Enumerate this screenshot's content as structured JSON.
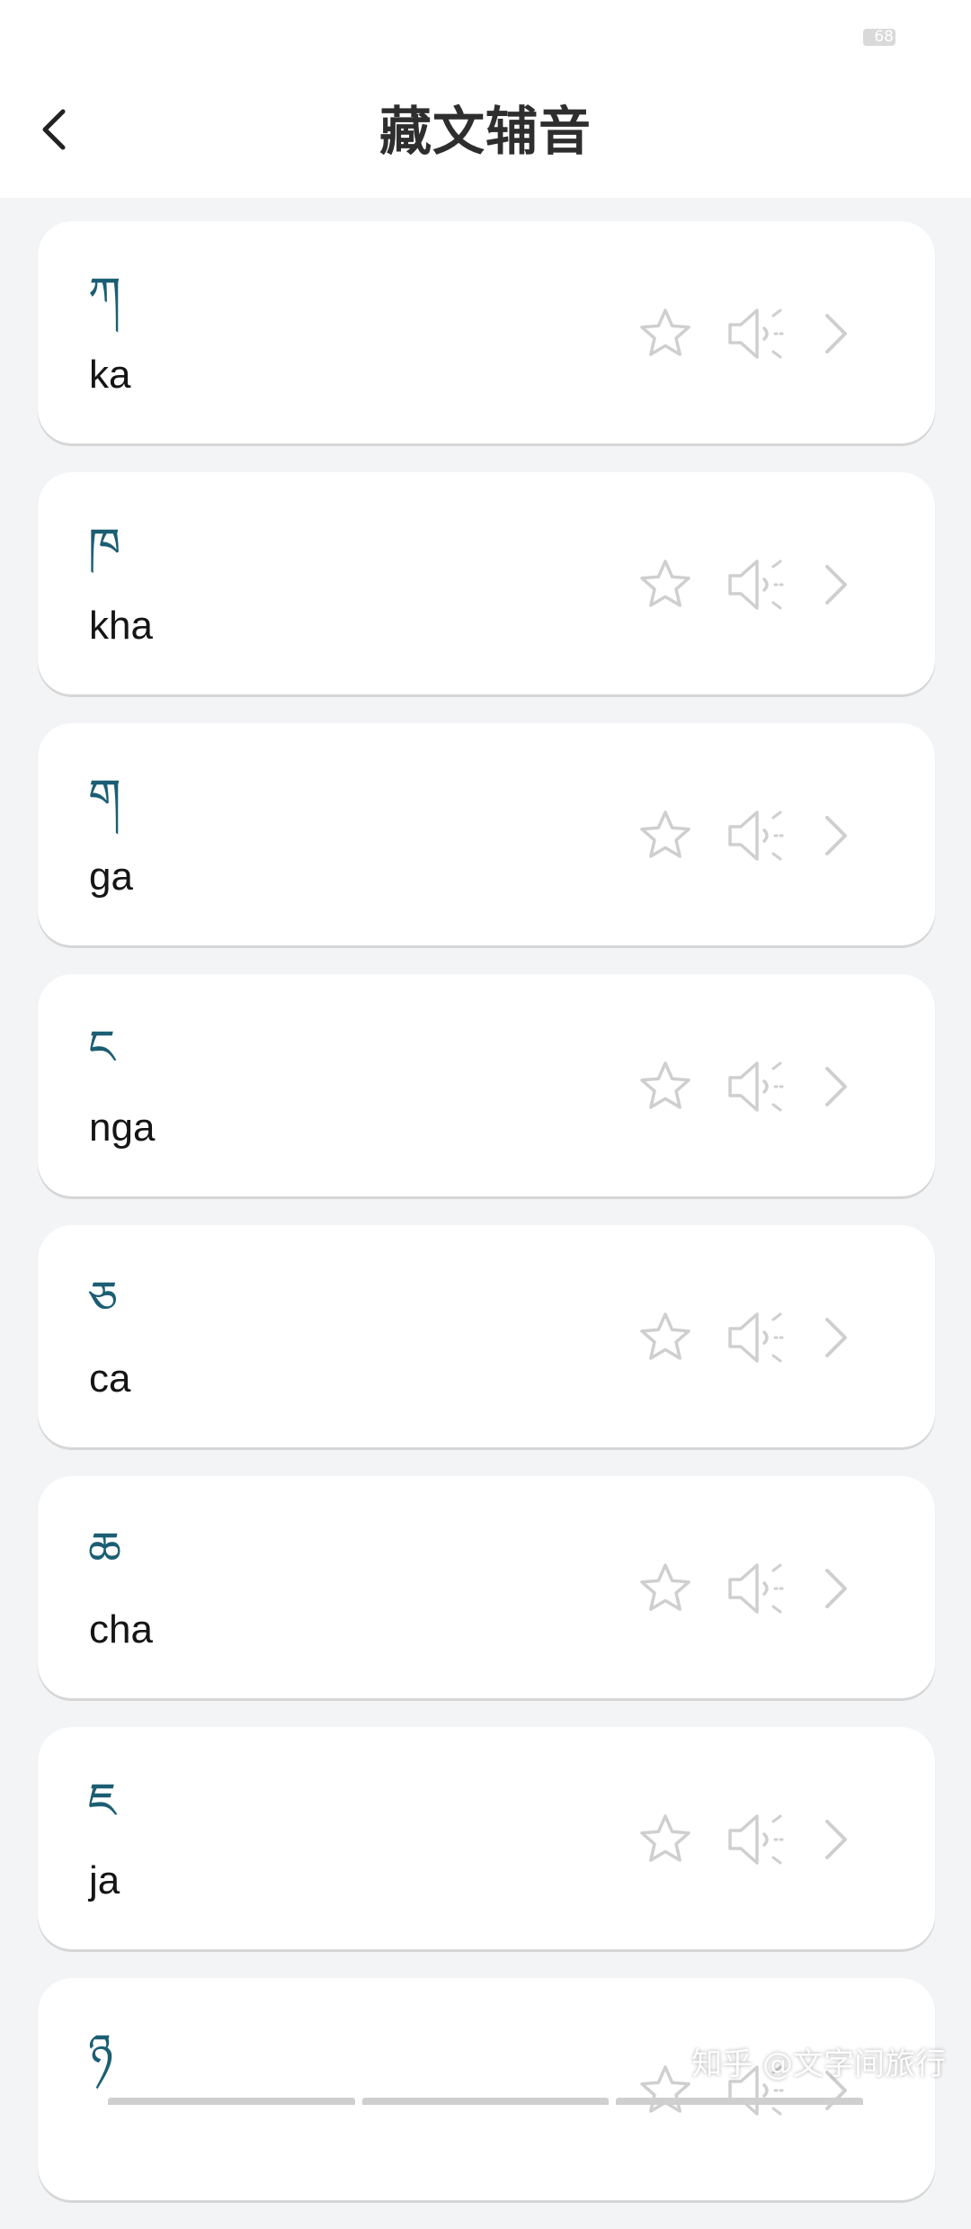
{
  "status_bar": {
    "battery_text": "68"
  },
  "header": {
    "title": "藏文辅音"
  },
  "items": [
    {
      "glyph": "ཀ",
      "roman": "ka"
    },
    {
      "glyph": "ཁ",
      "roman": "kha"
    },
    {
      "glyph": "ག",
      "roman": "ga"
    },
    {
      "glyph": "ང",
      "roman": "nga"
    },
    {
      "glyph": "ཅ",
      "roman": "ca"
    },
    {
      "glyph": "ཆ",
      "roman": "cha"
    },
    {
      "glyph": "ཇ",
      "roman": "ja"
    },
    {
      "glyph": "ཉ",
      "roman": ""
    }
  ],
  "icons": {
    "favorite": "star-icon",
    "play_audio": "speaker-icon",
    "open_detail": "chevron-right-icon",
    "back": "chevron-left-icon"
  },
  "colors": {
    "accent_glyph": "#1b5e73",
    "icon_gray": "#cfcfcf",
    "background": "#f3f4f6"
  },
  "watermark": "知乎 @文字间旅行"
}
